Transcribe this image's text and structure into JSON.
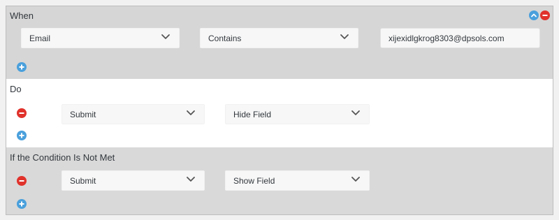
{
  "when": {
    "title": "When",
    "field_select": "Email",
    "operator_select": "Contains",
    "value_input": "xijexidlgkrog8303@dpsols.com"
  },
  "do": {
    "title": "Do",
    "action_select": "Submit",
    "effect_select": "Hide Field"
  },
  "else": {
    "title": "If the Condition Is Not Met",
    "action_select": "Submit",
    "effect_select": "Show Field"
  },
  "colors": {
    "add_blue": "#4aa0dc",
    "remove_red": "#e0322b",
    "when_bg": "#d6d6d6",
    "do_bg": "#ffffff",
    "else_bg": "#d9d9d9"
  },
  "icons": [
    "chevron-up-icon",
    "remove-icon",
    "add-icon",
    "chevron-down-icon"
  ]
}
